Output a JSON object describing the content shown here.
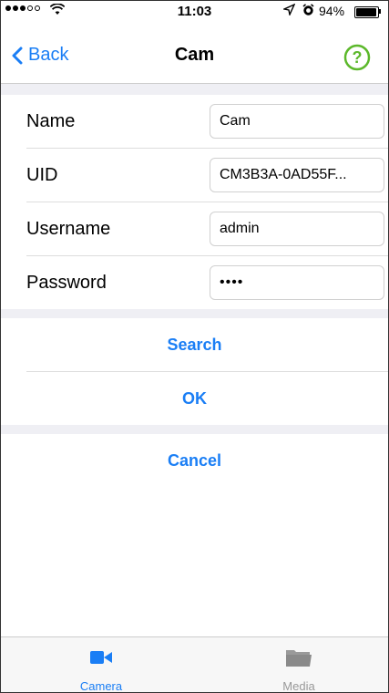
{
  "status": {
    "time": "11:03",
    "battery": "94%",
    "battery_level": 0.94
  },
  "nav": {
    "back_label": "Back",
    "title": "Cam"
  },
  "form": {
    "fields": [
      {
        "label": "Name",
        "value": "Cam"
      },
      {
        "label": "UID",
        "value": "CM3B3A-0AD55F..."
      },
      {
        "label": "Username",
        "value": "admin"
      },
      {
        "label": "Password",
        "value": "••••"
      }
    ]
  },
  "actions": {
    "search": "Search",
    "ok": "OK",
    "cancel": "Cancel"
  },
  "tabs": [
    {
      "label": "Camera",
      "icon": "video-camera-icon",
      "active": true
    },
    {
      "label": "Media",
      "icon": "folder-icon",
      "active": false
    }
  ],
  "colors": {
    "accent": "#1a7ef5",
    "help_green": "#5cb82b"
  }
}
